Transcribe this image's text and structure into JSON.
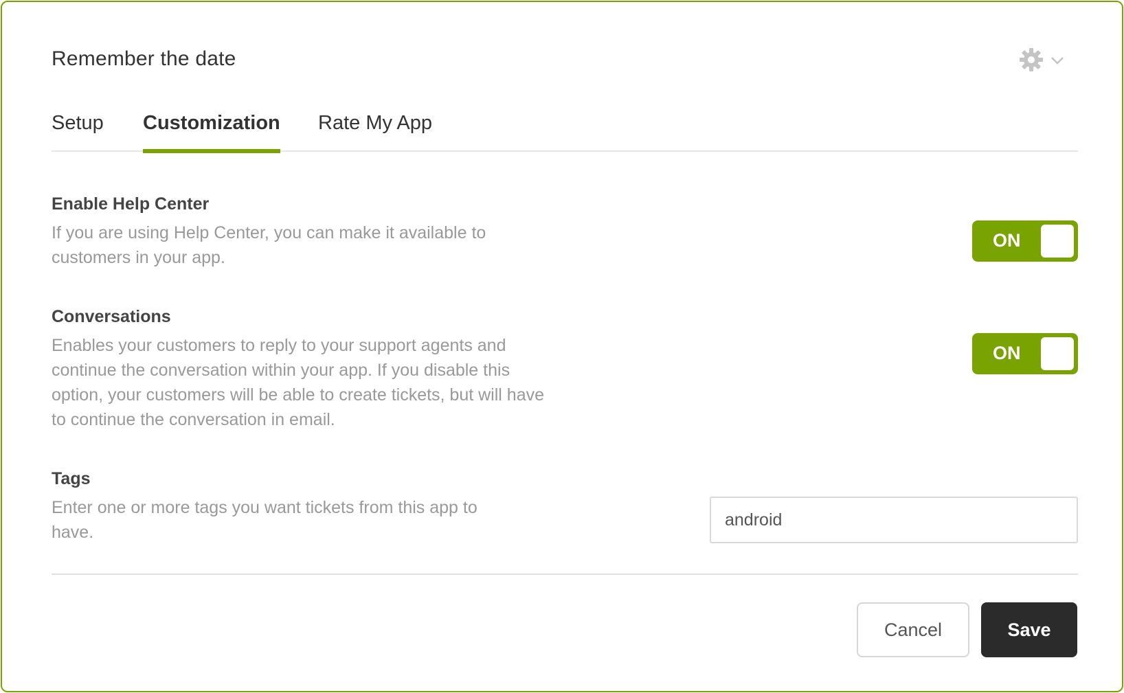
{
  "dialog": {
    "title": "Remember the date"
  },
  "header": {
    "settings_icon": "gear-icon",
    "dropdown_icon": "chevron-down-icon"
  },
  "tabs": [
    {
      "label": "Setup",
      "active": false
    },
    {
      "label": "Customization",
      "active": true
    },
    {
      "label": "Rate My App",
      "active": false
    }
  ],
  "sections": {
    "help_center": {
      "title": "Enable Help Center",
      "description": "If you are using Help Center, you can make it available to customers in your app.",
      "toggle_label": "ON"
    },
    "conversations": {
      "title": "Conversations",
      "description": "Enables your customers to reply to your support agents and continue the conversation within your app. If you disable this option, your customers will be able to create tickets, but will have to continue the conversation in email.",
      "toggle_label": "ON"
    },
    "tags": {
      "title": "Tags",
      "description": "Enter one or more tags you want tickets from this app to have.",
      "value": "android"
    }
  },
  "footer": {
    "cancel_label": "Cancel",
    "save_label": "Save"
  },
  "colors": {
    "accent": "#78a300",
    "save_button": "#2b2b2b"
  }
}
